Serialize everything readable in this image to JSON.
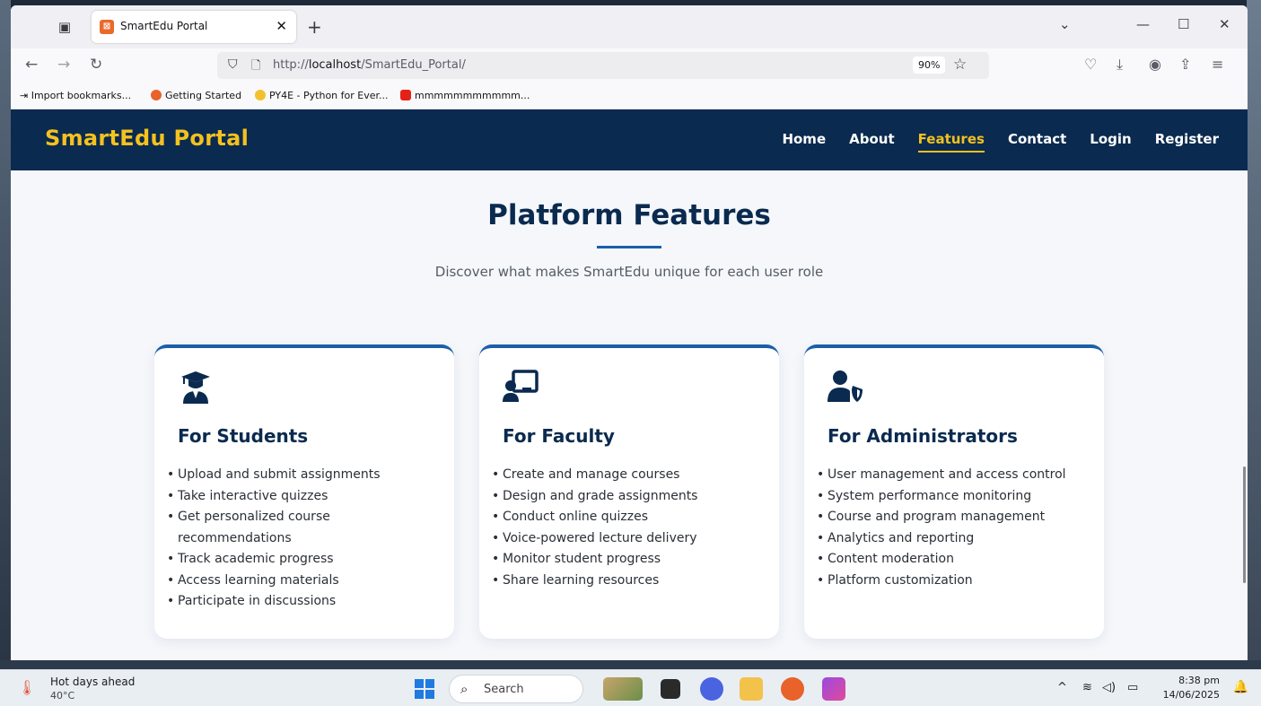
{
  "browser": {
    "tab_title": "SmartEdu Portal",
    "tab_favicon_glyph": "⊠",
    "new_tab_glyph": "+",
    "url_prefix": "http://",
    "url_host": "localhost",
    "url_path": "/SmartEdu_Portal/",
    "zoom": "90%",
    "bookmarks": [
      {
        "label": "Import bookmarks...",
        "icon": "import-icon"
      },
      {
        "label": "Getting Started",
        "icon": "firefox-icon"
      },
      {
        "label": "PY4E - Python for Ever...",
        "icon": "python-icon"
      },
      {
        "label": "mmmmmmmmmmm...",
        "icon": "youtube-icon"
      }
    ]
  },
  "site": {
    "brand": "SmartEdu Portal",
    "nav": [
      "Home",
      "About",
      "Features",
      "Contact",
      "Login",
      "Register"
    ],
    "active_nav": "Features",
    "section_title": "Platform Features",
    "section_subtitle": "Discover what makes SmartEdu unique for each user role",
    "cards": [
      {
        "title": "For Students",
        "icon": "graduate-icon",
        "items": [
          "Upload and submit assignments",
          "Take interactive quizzes",
          "Get personalized course recommendations",
          "Track academic progress",
          "Access learning materials",
          "Participate in discussions"
        ]
      },
      {
        "title": "For Faculty",
        "icon": "teacher-board-icon",
        "items": [
          "Create and manage courses",
          "Design and grade assignments",
          "Conduct online quizzes",
          "Voice-powered lecture delivery",
          "Monitor student progress",
          "Share learning resources"
        ]
      },
      {
        "title": "For Administrators",
        "icon": "user-shield-icon",
        "items": [
          "User management and access control",
          "System performance monitoring",
          "Course and program management",
          "Analytics and reporting",
          "Content moderation",
          "Platform customization"
        ]
      }
    ],
    "colors": {
      "header_bg": "#0a2a4f",
      "brand": "#f4c11f",
      "accent": "#1a5fa8"
    }
  },
  "taskbar": {
    "weather_title": "Hot days ahead",
    "weather_temp": "40°C",
    "search_placeholder": "Search",
    "time": "8:38 pm",
    "date": "14/06/2025"
  }
}
